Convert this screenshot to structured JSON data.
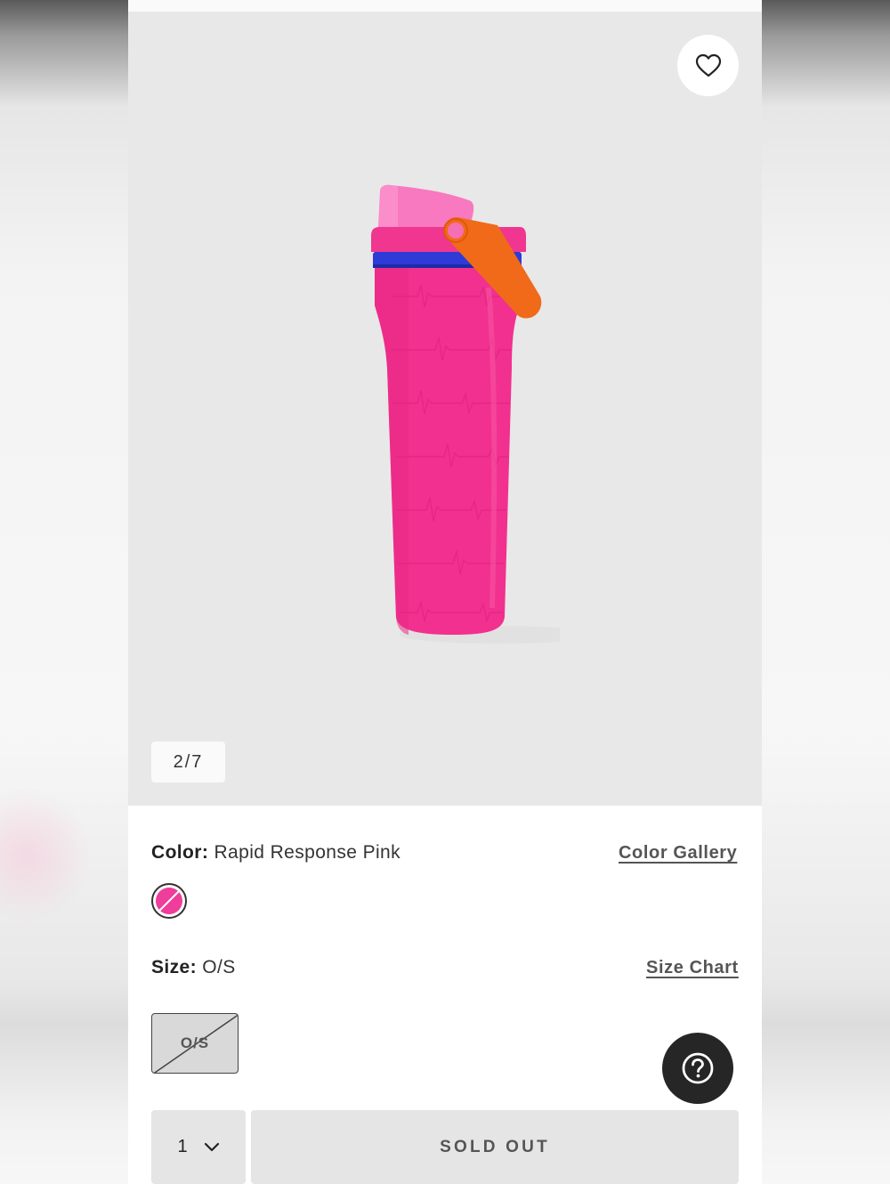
{
  "gallery": {
    "counter": "2/7",
    "favorite_icon": "heart-icon",
    "product_image": "pink water bottle with orange carry loop"
  },
  "color": {
    "label": "Color:",
    "value": "Rapid Response Pink",
    "gallery_link": "Color Gallery",
    "swatch_color": "#ee3d9a"
  },
  "size": {
    "label": "Size:",
    "value": "O/S",
    "chart_link": "Size Chart",
    "option": "O/S"
  },
  "purchase": {
    "quantity": "1",
    "button_label": "SOLD OUT"
  },
  "help": {
    "icon": "question-icon"
  },
  "colors": {
    "bottle_pink": "#f2308f",
    "accent_orange": "#f06a1a",
    "band_blue": "#2f3bd6",
    "dark": "#262626"
  }
}
